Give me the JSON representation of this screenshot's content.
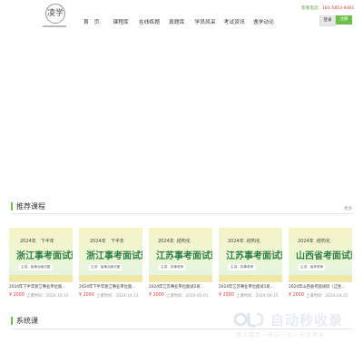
{
  "header": {
    "logo_text": "凌学",
    "nav": [
      "首　页",
      "课程库",
      "在线练题",
      "真题库",
      "学员风采",
      "考试资讯",
      "逸学动论"
    ],
    "hotline_label": "客服电话：",
    "hotline_number": "181-5853-8361",
    "login_label": "登录",
    "register_label": "注册"
  },
  "recommended": {
    "title": "推荐课程",
    "more_label": "更多",
    "courses": [
      {
        "thumb_year": "2024年　下半年",
        "thumb_title": "浙江事考面试班",
        "thumb_pill": "主讲：省事业面试团",
        "name": "2024年下半年浙江事业单位面...",
        "price": "¥ 2000",
        "date": "上课时间：2024-10-13"
      },
      {
        "thumb_year": "2024年　下半年",
        "thumb_title": "浙江事考面试班",
        "thumb_pill": "主讲：省事业面试团",
        "name": "2024年下半年浙江事业单位面...",
        "price": "¥ 2000",
        "date": "上课时间：2024-10-13"
      },
      {
        "thumb_year": "2024年 .结构化",
        "thumb_title": "江苏事考面试班",
        "thumb_pill": "主讲：苏事老师",
        "name": "2024年江苏事业单位面试2班...",
        "price": "¥ 2000",
        "date": "上课时间：2024-05-01"
      },
      {
        "thumb_year": "2024年 .结构化",
        "thumb_title": "江苏事考面试班",
        "thumb_pill": "主讲：苏事老师",
        "name": "2024年江苏事业单位面试1班...",
        "price": "¥ 2000",
        "date": "上课时间：2024-04-25"
      },
      {
        "thumb_year": "2024年 .结构化",
        "thumb_title": "山西省考面试班",
        "thumb_pill": "主讲：省考老师",
        "name": "2024年山西省考面试班（辽金...",
        "price": "¥ 2000",
        "date": "上课时间：2024-04-25"
      }
    ]
  },
  "system": {
    "title": "系统课"
  },
  "watermark": {
    "text": "自动秒收录",
    "sub": "做上精品一来访一次一自动收录"
  },
  "colors": {
    "accent": "#6cbf47",
    "price": "#e53935"
  }
}
